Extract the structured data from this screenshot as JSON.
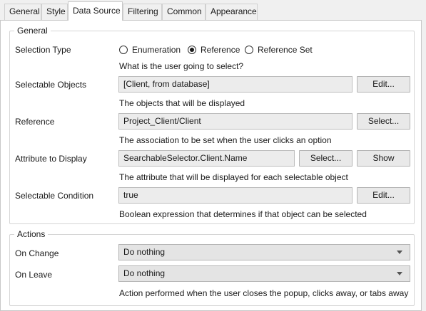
{
  "tabs": [
    {
      "label": "General",
      "active": false
    },
    {
      "label": "Style",
      "active": false
    },
    {
      "label": "Data Source",
      "active": true
    },
    {
      "label": "Filtering",
      "active": false
    },
    {
      "label": "Common",
      "active": false
    },
    {
      "label": "Appearance",
      "active": false
    }
  ],
  "general": {
    "title": "General",
    "selection_type": {
      "label": "Selection Type",
      "options": [
        {
          "label": "Enumeration",
          "selected": false
        },
        {
          "label": "Reference",
          "selected": true
        },
        {
          "label": "Reference Set",
          "selected": false
        }
      ],
      "help": "What is the user going to select?"
    },
    "selectable_objects": {
      "label": "Selectable Objects",
      "value": "[Client, from database]",
      "button": "Edit...",
      "help": "The objects that will be displayed"
    },
    "reference": {
      "label": "Reference",
      "value": "Project_Client/Client",
      "button": "Select...",
      "help": "The association to be set when the user clicks an option"
    },
    "attribute_to_display": {
      "label": "Attribute to Display",
      "value": "SearchableSelector.Client.Name",
      "select_button": "Select...",
      "show_button": "Show",
      "help": "The attribute that will be displayed for each selectable object"
    },
    "selectable_condition": {
      "label": "Selectable Condition",
      "value": "true",
      "button": "Edit...",
      "help": "Boolean expression that determines if that object can be selected"
    }
  },
  "actions": {
    "title": "Actions",
    "on_change": {
      "label": "On Change",
      "value": "Do nothing"
    },
    "on_leave": {
      "label": "On Leave",
      "value": "Do nothing"
    },
    "help": "Action performed when the user closes the popup, clicks away, or tabs away"
  }
}
